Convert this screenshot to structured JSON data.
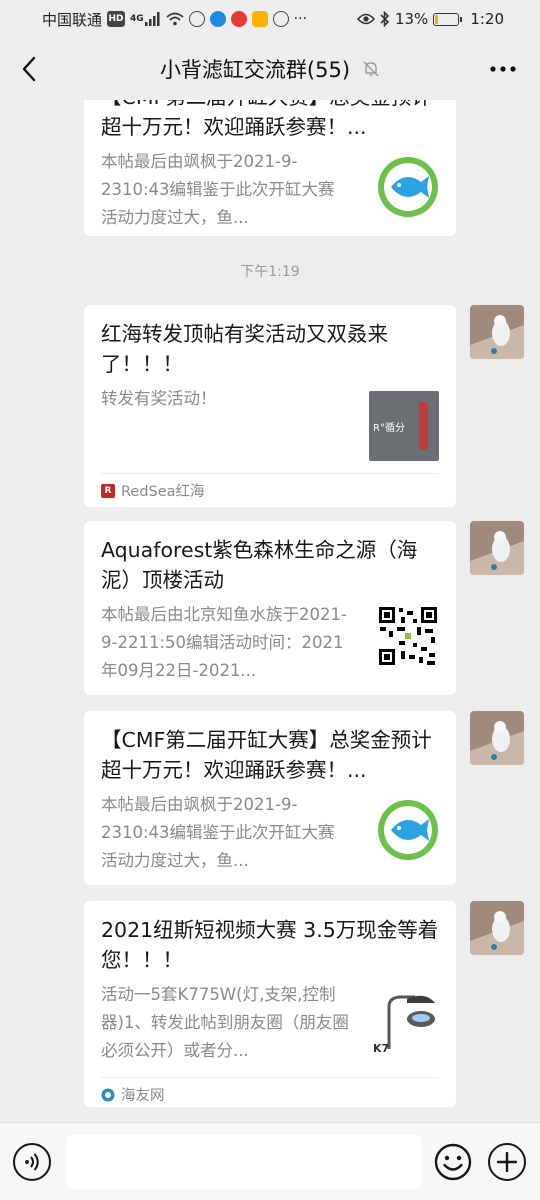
{
  "status_bar": {
    "carrier": "中国联通",
    "network_badge": "HD",
    "signal_label": "4G",
    "battery_percent": "13%",
    "battery_level": 0.13,
    "time": "1:20",
    "overflow": "···"
  },
  "header": {
    "title": "小背滤缸交流群(55)",
    "muted": true
  },
  "timestamp": "下午1:19",
  "messages": [
    {
      "title": "【CMF第二届开缸大赛】总奖金预计超十万元！欢迎踊跃参赛！...",
      "description": "本帖最后由飒枫于2021-9-2310:43编辑鉴于此次开缸大赛活动力度过大，鱼...",
      "thumb_icon": "fish-logo",
      "footer": ""
    },
    {
      "title": "红海转发顶帖有奖活动又双叒来了！！！",
      "description": "转发有奖活动！",
      "thumb_icon": "redsea-product-photo",
      "thumb_text": "R°循分",
      "footer": "RedSea红海",
      "footer_logo": "R"
    },
    {
      "title": "Aquaforest紫色森林生命之源（海泥）顶楼活动",
      "description": "本帖最后由北京知鱼水族于2021-9-2211:50编辑活动时间：2021年09月22日-2021...",
      "thumb_icon": "qr-code",
      "footer": ""
    },
    {
      "title": "【CMF第二届开缸大赛】总奖金预计超十万元！欢迎踊跃参赛！...",
      "description": "本帖最后由飒枫于2021-9-2310:43编辑鉴于此次开缸大赛活动力度过大，鱼...",
      "thumb_icon": "fish-logo",
      "footer": ""
    },
    {
      "title": "2021纽斯短视频大赛 3.5万现金等着您！！！",
      "description": "活动一5套K775W(灯,支架,控制器)1、转发此帖到朋友圈（朋友圈必须公开）或者分...",
      "thumb_icon": "aquarium-lamp-photo",
      "thumb_text": "K7",
      "footer": "海友网",
      "footer_logo": "haiyou-logo"
    }
  ],
  "icons": {
    "back": "chevron-left-icon",
    "mute": "bell-off-icon",
    "more": "more-icon",
    "voice": "voice-icon",
    "emoji": "emoji-icon",
    "plus": "plus-icon"
  },
  "colors": {
    "background": "#ededed",
    "card": "#ffffff",
    "secondary_text": "#8a8a8a"
  }
}
